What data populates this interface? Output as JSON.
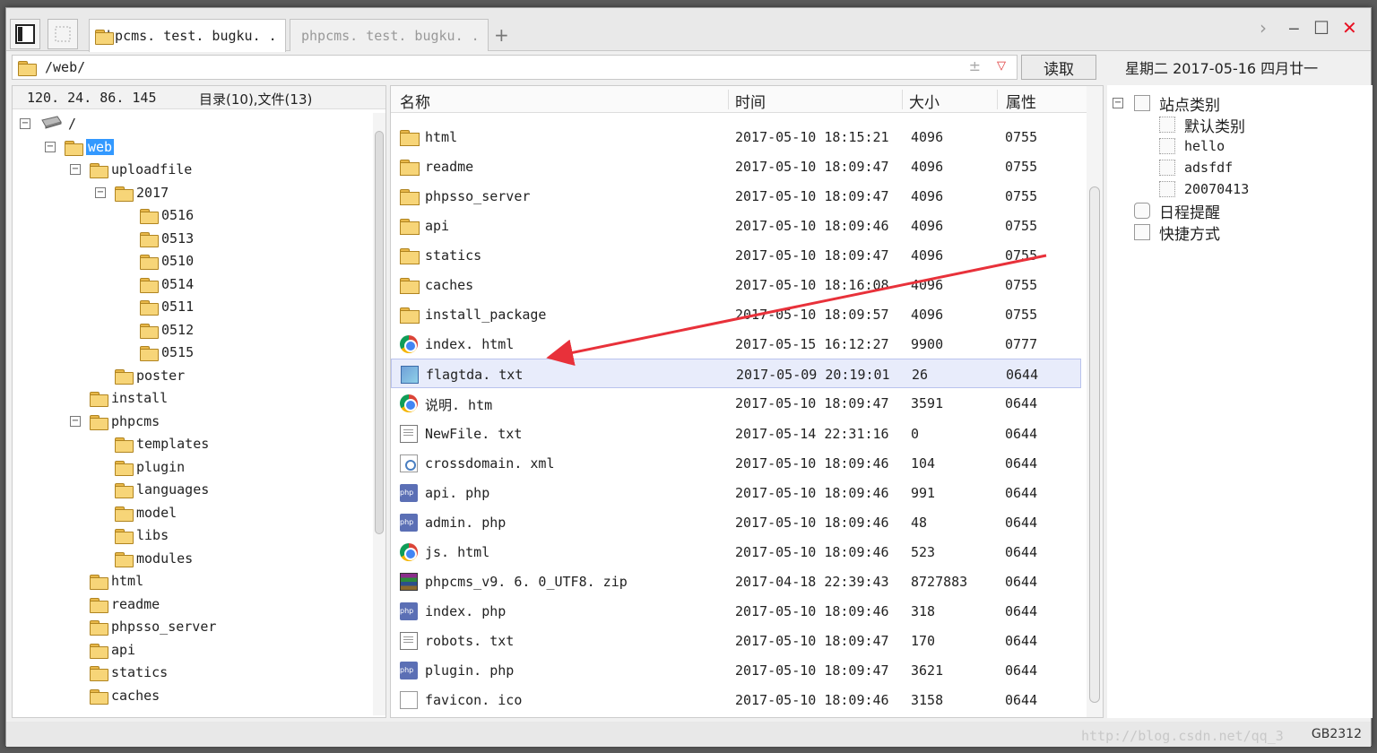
{
  "tabs": [
    {
      "label": "phpcms. test. bugku. . .",
      "active": true
    },
    {
      "label": "phpcms. test. bugku. . .",
      "active": false
    }
  ],
  "tab_add": "+",
  "window_controls": {
    "next": "›",
    "minimize": "‒",
    "maximize": "☐",
    "close": "✕"
  },
  "address": {
    "path": "/web/",
    "pm": "±",
    "dropdown": "▽"
  },
  "read_button": "读取",
  "date_text": "星期二 2017-05-16 四月廿一",
  "left_header": {
    "ip": "120. 24. 86. 145",
    "count": "目录(10),文件(13)"
  },
  "tree": [
    {
      "label": "/",
      "depth": 0,
      "exp": "⊟",
      "drive": true
    },
    {
      "label": "web",
      "depth": 1,
      "exp": "⊟",
      "selected": true
    },
    {
      "label": "uploadfile",
      "depth": 2,
      "exp": "⊟"
    },
    {
      "label": "2017",
      "depth": 3,
      "exp": "⊟"
    },
    {
      "label": "0516",
      "depth": 4
    },
    {
      "label": "0513",
      "depth": 4
    },
    {
      "label": "0510",
      "depth": 4
    },
    {
      "label": "0514",
      "depth": 4
    },
    {
      "label": "0511",
      "depth": 4
    },
    {
      "label": "0512",
      "depth": 4
    },
    {
      "label": "0515",
      "depth": 4
    },
    {
      "label": "poster",
      "depth": 3
    },
    {
      "label": "install",
      "depth": 2
    },
    {
      "label": "phpcms",
      "depth": 2,
      "exp": "⊟"
    },
    {
      "label": "templates",
      "depth": 3
    },
    {
      "label": "plugin",
      "depth": 3
    },
    {
      "label": "languages",
      "depth": 3
    },
    {
      "label": "model",
      "depth": 3
    },
    {
      "label": "libs",
      "depth": 3
    },
    {
      "label": "modules",
      "depth": 3
    },
    {
      "label": "html",
      "depth": 2
    },
    {
      "label": "readme",
      "depth": 2
    },
    {
      "label": "phpsso_server",
      "depth": 2
    },
    {
      "label": "api",
      "depth": 2
    },
    {
      "label": "statics",
      "depth": 2
    },
    {
      "label": "caches",
      "depth": 2
    }
  ],
  "columns": {
    "name": "名称",
    "time": "时间",
    "size": "大小",
    "attr": "属性"
  },
  "files": [
    {
      "icon": "folder",
      "name": "html",
      "time": "2017-05-10 18:15:21",
      "size": "4096",
      "attr": "0755"
    },
    {
      "icon": "folder",
      "name": "readme",
      "time": "2017-05-10 18:09:47",
      "size": "4096",
      "attr": "0755"
    },
    {
      "icon": "folder",
      "name": "phpsso_server",
      "time": "2017-05-10 18:09:47",
      "size": "4096",
      "attr": "0755"
    },
    {
      "icon": "folder",
      "name": "api",
      "time": "2017-05-10 18:09:46",
      "size": "4096",
      "attr": "0755"
    },
    {
      "icon": "folder",
      "name": "statics",
      "time": "2017-05-10 18:09:47",
      "size": "4096",
      "attr": "0755"
    },
    {
      "icon": "folder",
      "name": "caches",
      "time": "2017-05-10 18:16:08",
      "size": "4096",
      "attr": "0755"
    },
    {
      "icon": "folder",
      "name": "install_package",
      "time": "2017-05-10 18:09:57",
      "size": "4096",
      "attr": "0755"
    },
    {
      "icon": "chrome",
      "name": "index. html",
      "time": "2017-05-15 16:12:27",
      "size": "9900",
      "attr": "0777"
    },
    {
      "icon": "txt2",
      "name": "flagtda. txt",
      "time": "2017-05-09 20:19:01",
      "size": "26",
      "attr": "0644",
      "highlight": true
    },
    {
      "icon": "chrome",
      "name": "说明. htm",
      "time": "2017-05-10 18:09:47",
      "size": "3591",
      "attr": "0644"
    },
    {
      "icon": "txt",
      "name": "NewFile. txt",
      "time": "2017-05-14 22:31:16",
      "size": "0",
      "attr": "0644"
    },
    {
      "icon": "xml",
      "name": "crossdomain. xml",
      "time": "2017-05-10 18:09:46",
      "size": "104",
      "attr": "0644"
    },
    {
      "icon": "php",
      "name": "api. php",
      "time": "2017-05-10 18:09:46",
      "size": "991",
      "attr": "0644"
    },
    {
      "icon": "php",
      "name": "admin. php",
      "time": "2017-05-10 18:09:46",
      "size": "48",
      "attr": "0644"
    },
    {
      "icon": "chrome",
      "name": "js. html",
      "time": "2017-05-10 18:09:46",
      "size": "523",
      "attr": "0644"
    },
    {
      "icon": "zip",
      "name": "phpcms_v9. 6. 0_UTF8. zip",
      "time": "2017-04-18 22:39:43",
      "size": "8727883",
      "attr": "0644"
    },
    {
      "icon": "php",
      "name": "index. php",
      "time": "2017-05-10 18:09:46",
      "size": "318",
      "attr": "0644"
    },
    {
      "icon": "txt",
      "name": "robots. txt",
      "time": "2017-05-10 18:09:47",
      "size": "170",
      "attr": "0644"
    },
    {
      "icon": "php",
      "name": "plugin. php",
      "time": "2017-05-10 18:09:47",
      "size": "3621",
      "attr": "0644"
    },
    {
      "icon": "file",
      "name": "favicon. ico",
      "time": "2017-05-10 18:09:46",
      "size": "3158",
      "attr": "0644"
    }
  ],
  "right_tree": [
    {
      "label": "站点类别",
      "depth": 0,
      "exp": "⊟",
      "icon": "box"
    },
    {
      "label": "默认类别",
      "depth": 1,
      "icon": "dotted"
    },
    {
      "label": "hello",
      "depth": 1,
      "icon": "dotted",
      "mono": true
    },
    {
      "label": "adsfdf",
      "depth": 1,
      "icon": "dotted",
      "mono": true
    },
    {
      "label": "20070413",
      "depth": 1,
      "icon": "dotted",
      "mono": true
    },
    {
      "label": "日程提醒",
      "depth": 0,
      "icon": "clock"
    },
    {
      "label": "快捷方式",
      "depth": 0,
      "icon": "hand"
    }
  ],
  "encoding": "GB2312",
  "watermark": "http://blog.csdn.net/qq_3",
  "colors": {
    "selection": "#3399ff",
    "highlight_row": "#e8ecfb",
    "arrow": "#e8313a",
    "close": "#e81123"
  }
}
